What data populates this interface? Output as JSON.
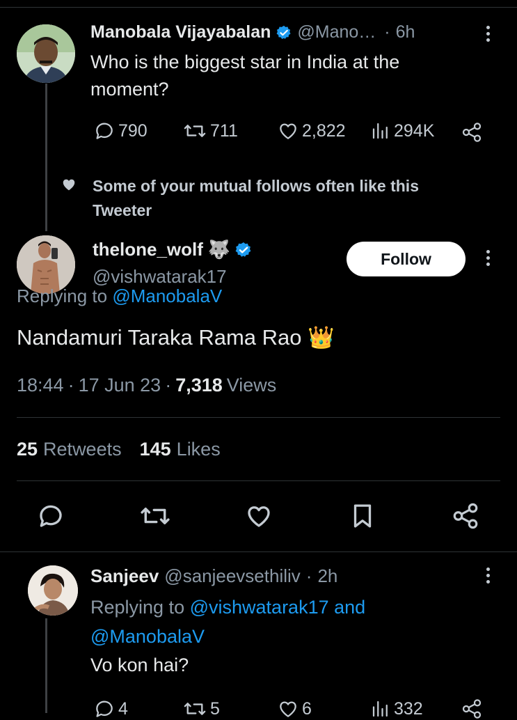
{
  "tweet1": {
    "name": "Manobala Vijayabalan",
    "handle": "@Mano…",
    "dot": "·",
    "time": "6h",
    "text": "Who is the biggest star in India at the moment?",
    "replies": "790",
    "retweets": "711",
    "likes": "2,822",
    "views": "294K"
  },
  "social_context": {
    "text": "Some of your mutual follows often like this Tweeter"
  },
  "main_tweet": {
    "name": "thelone_wolf",
    "name_emoji": "🐺",
    "handle": "@vishwatarak17",
    "follow_label": "Follow",
    "replying_prefix": "Replying to",
    "replying_handle": "@ManobalaV",
    "text": "Nandamuri Taraka Rama Rao",
    "text_emoji": "👑",
    "time": "18:44",
    "sep1": "·",
    "date": "17 Jun 23",
    "sep2": "·",
    "views_count": "7,318",
    "views_label": "Views",
    "retweets_count": "25",
    "retweets_label": "Retweets",
    "likes_count": "145",
    "likes_label": "Likes"
  },
  "reply": {
    "name": "Sanjeev",
    "handle": "@sanjeevsethiliv",
    "dot": "·",
    "time": "2h",
    "replying_prefix": "Replying to",
    "replying_handle1": "@vishwatarak17",
    "replying_and": "and",
    "replying_handle2": "@ManobalaV",
    "text": "Vo kon hai?",
    "replies": "4",
    "retweets": "5",
    "likes": "6",
    "views": "332"
  },
  "colors": {
    "background": "#000000",
    "accent": "#1d9bf0",
    "verified": "#1d9bf0",
    "text_primary": "#e7e9ea",
    "text_secondary": "#8b98a5",
    "divider": "#2f3336"
  },
  "icons": [
    "verified-badge-icon",
    "more-icon",
    "reply-icon",
    "retweet-icon",
    "like-icon",
    "views-icon",
    "share-icon",
    "heart-icon",
    "bookmark-icon"
  ]
}
